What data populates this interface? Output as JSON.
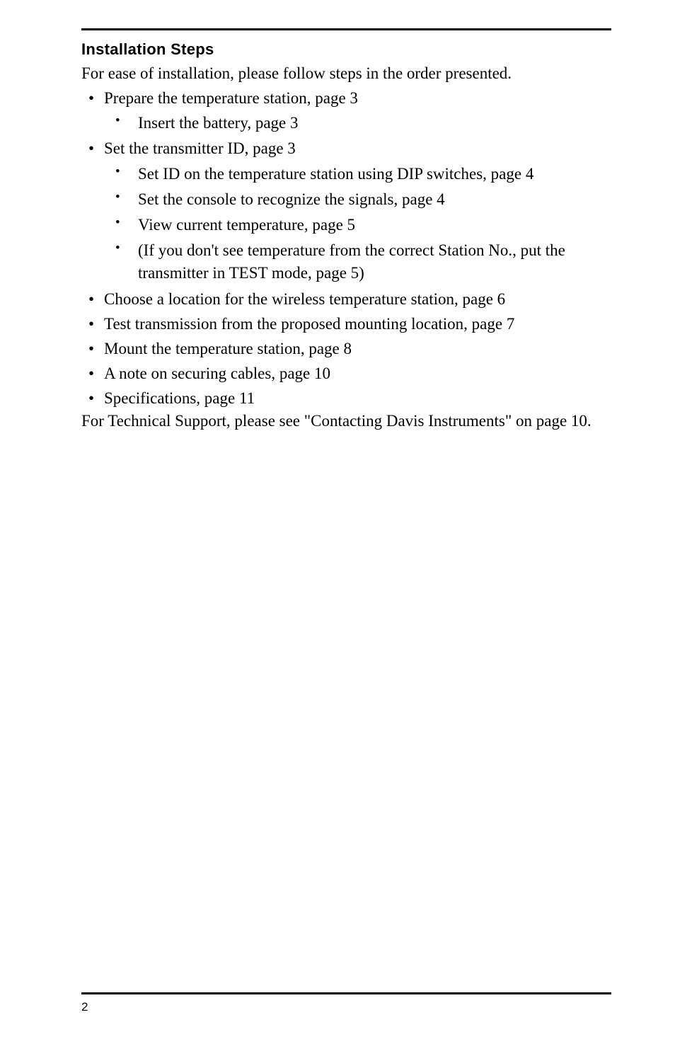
{
  "heading": "Installation Steps",
  "intro": "For ease of installation, please follow steps in the order presented.",
  "items": [
    {
      "text": "Prepare the temperature station, page 3",
      "children": [
        {
          "text": "Insert the battery, page 3"
        }
      ]
    },
    {
      "text": "Set the transmitter ID, page 3",
      "children": [
        {
          "text": "Set ID on the temperature station using DIP switches, page 4"
        },
        {
          "text": "Set the console to recognize the signals, page 4"
        },
        {
          "text": "View current temperature, page 5"
        },
        {
          "text": "(If you don't see temperature from the correct Station No., put the transmitter in TEST mode, page 5)"
        }
      ]
    },
    {
      "text": "Choose a location for the wireless temperature station, page 6"
    },
    {
      "text": "Test transmission from the proposed mounting location, page 7"
    },
    {
      "text": "Mount the temperature station, page 8"
    },
    {
      "text": "A note on securing cables, page 10"
    },
    {
      "text": "Specifications, page 11"
    }
  ],
  "outro": "For Technical Support, please see \"Contacting Davis Instruments\" on page 10.",
  "pageNumber": "2"
}
